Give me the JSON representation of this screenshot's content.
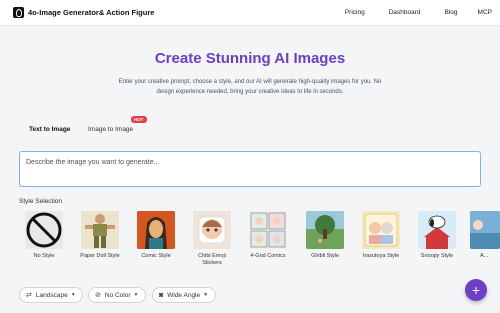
{
  "header": {
    "app_title": "4o-Image Generator& Action Figure",
    "nav": [
      "Pricing",
      "Dashboard",
      "Blog",
      "MCP"
    ]
  },
  "hero": {
    "title": "Create Stunning AI Images",
    "subtitle": "Enter your creative prompt, choose a style, and our AI will generate high-quality images for you. No design experience needed, bring your creative ideas to life in seconds."
  },
  "tabs": {
    "text_to_image": "Text to Image",
    "image_to_image": "Image to Image",
    "hot_badge": "HOT"
  },
  "prompt": {
    "placeholder": "Describe the image you want to generate..."
  },
  "style_section": {
    "label": "Style Selection",
    "styles": [
      {
        "label": "No Style",
        "icon": "no-style-icon"
      },
      {
        "label": "Paper Doll Style"
      },
      {
        "label": "Comic Style"
      },
      {
        "label": "Chibi Emoji Stickers"
      },
      {
        "label": "4-Grid Comics"
      },
      {
        "label": "Ghibli Style"
      },
      {
        "label": "Irasutoya Style"
      },
      {
        "label": "Snoopy Style"
      },
      {
        "label": "A..."
      }
    ]
  },
  "options": {
    "orientation": "Landscape",
    "color": "No Color",
    "angle": "Wide Angle"
  },
  "colors": {
    "accent": "#6b3fc6",
    "badge": "#e53e4a",
    "prompt_border": "#7fb3ea"
  }
}
